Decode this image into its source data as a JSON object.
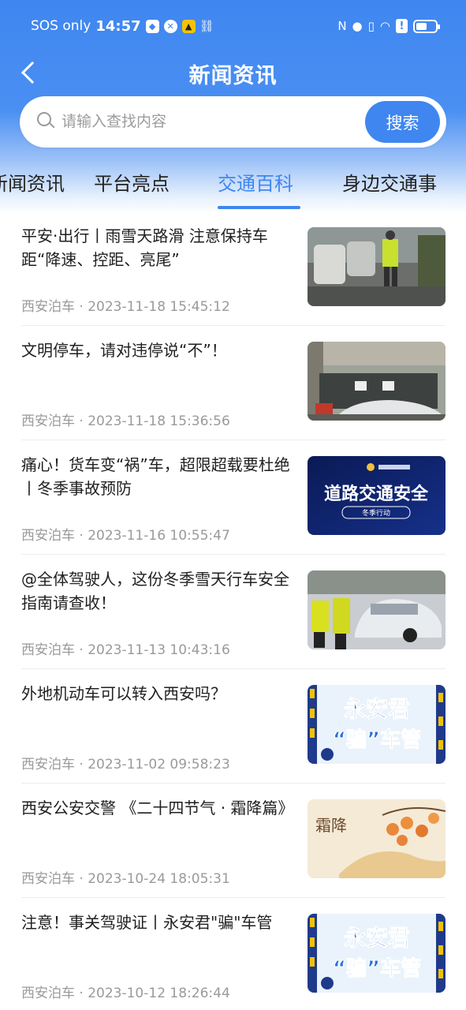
{
  "status_bar": {
    "carrier": "SOS only",
    "time": "14:57",
    "alert_mark": "!",
    "battery_level": 0.55
  },
  "nav": {
    "title": "新闻资讯"
  },
  "search": {
    "placeholder": "请输入查找内容",
    "value": "",
    "button_label": "搜索"
  },
  "tabs": [
    {
      "label": "新闻资讯",
      "active": false
    },
    {
      "label": "平台亮点",
      "active": false
    },
    {
      "label": "交通百科",
      "active": true
    },
    {
      "label": "身边交通事",
      "active": false
    }
  ],
  "news": [
    {
      "title": "平安·出行丨雨雪天路滑 注意保持车距“降速、控距、亮尾”",
      "source": "西安泊车",
      "date": "2023-11-18 15:45:12",
      "thumb_text": "",
      "thumb_sub": ""
    },
    {
      "title": "文明停车，请对违停说“不”！",
      "source": "西安泊车",
      "date": "2023-11-18 15:36:56",
      "thumb_text": "",
      "thumb_sub": ""
    },
    {
      "title": "痛心！货车变“祸”车，超限超载要杜绝丨冬季事故预防",
      "source": "西安泊车",
      "date": "2023-11-16 10:55:47",
      "thumb_text": "道路交通安全",
      "thumb_sub": "冬季行动"
    },
    {
      "title": "@全体驾驶人，这份冬季雪天行车安全指南请查收！",
      "source": "西安泊车",
      "date": "2023-11-13 10:43:16",
      "thumb_text": "",
      "thumb_sub": ""
    },
    {
      "title": "外地机动车可以转入西安吗？",
      "source": "西安泊车",
      "date": "2023-11-02 09:58:23",
      "thumb_text": "永安君",
      "thumb_sub": "“骗”车管"
    },
    {
      "title": "西安公安交警 《二十四节气 · 霜降篇》",
      "source": "西安泊车",
      "date": "2023-10-24 18:05:31",
      "thumb_text": "霜降",
      "thumb_sub": ""
    },
    {
      "title": "注意！事关驾驶证丨永安君\"骗\"车管",
      "source": "西安泊车",
      "date": "2023-10-12 18:26:44",
      "thumb_text": "永安君",
      "thumb_sub": "“骗”车管"
    }
  ]
}
